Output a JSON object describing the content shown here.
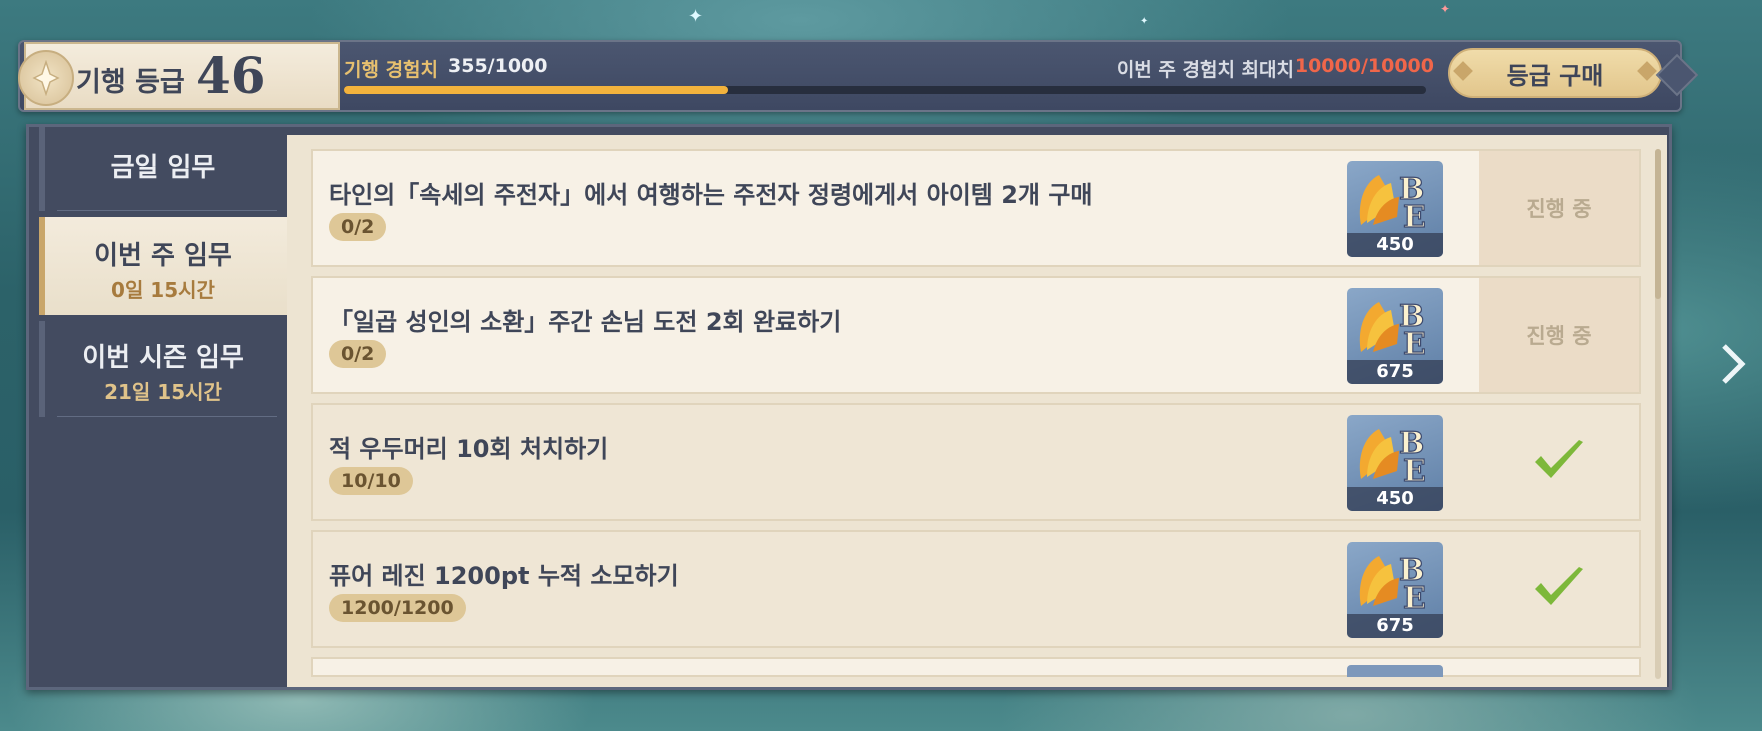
{
  "header": {
    "level_label": "기행 등급",
    "level_value": "46",
    "exp_label": "기행 경험치",
    "exp_value": "355/1000",
    "exp_progress": 0.355,
    "weekly_cap_label": "이번 주 경험치 최대치",
    "weekly_cap_value": "10000/10000",
    "buy_label": "등급 구매"
  },
  "sidebar": {
    "tabs": [
      {
        "title": "금일 임무",
        "subtitle": ""
      },
      {
        "title": "이번 주 임무",
        "subtitle": "0일 15시간"
      },
      {
        "title": "이번 시즌 임무",
        "subtitle": "21일 15시간"
      }
    ],
    "active_index": 1
  },
  "missions": [
    {
      "title": "타인의「속세의 주전자」에서 여행하는 주전자 정령에게서 아이템 2개 구매",
      "progress": "0/2",
      "reward": "450",
      "status": "진행 중",
      "completed": false
    },
    {
      "title": "「일곱 성인의 소환」주간 손님 도전 2회 완료하기",
      "progress": "0/2",
      "reward": "675",
      "status": "진행 중",
      "completed": false
    },
    {
      "title": "적 우두머리 10회 처치하기",
      "progress": "10/10",
      "reward": "450",
      "status": "",
      "completed": true
    },
    {
      "title": "퓨어 레진 1200pt 누적 소모하기",
      "progress": "1200/1200",
      "reward": "675",
      "status": "",
      "completed": true
    }
  ],
  "colors": {
    "accent_gold": "#f3b33d",
    "weekly_cap_red": "#f0664a",
    "check_green": "#7db83a"
  },
  "icons": {
    "level_emblem": "star-emblem-icon",
    "reward": "bp-exp-icon",
    "completed": "checkmark-icon",
    "next": "chevron-right-icon"
  }
}
